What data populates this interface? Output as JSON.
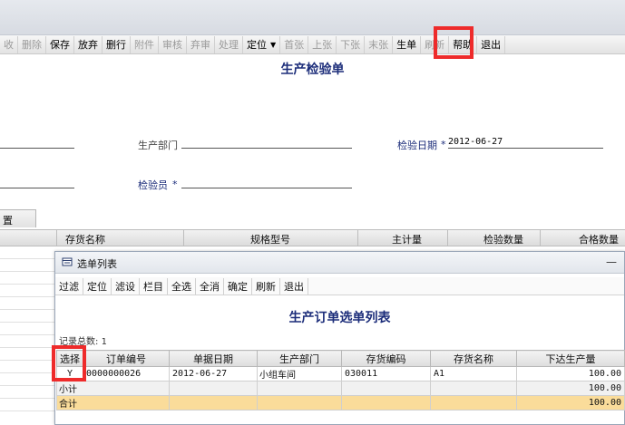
{
  "toolbar": {
    "items": [
      {
        "label": "收",
        "disabled": true
      },
      {
        "label": "删除",
        "disabled": true
      },
      {
        "label": "保存",
        "disabled": false
      },
      {
        "label": "放弃",
        "disabled": false
      },
      {
        "label": "删行",
        "disabled": false
      },
      {
        "label": "附件",
        "disabled": true
      },
      {
        "label": "审核",
        "disabled": true
      },
      {
        "label": "弃审",
        "disabled": true
      },
      {
        "label": "处理",
        "disabled": true
      },
      {
        "label": "定位",
        "disabled": false
      },
      {
        "label": "首张",
        "disabled": true
      },
      {
        "label": "上张",
        "disabled": true
      },
      {
        "label": "下张",
        "disabled": true
      },
      {
        "label": "末张",
        "disabled": true
      },
      {
        "label": "生单",
        "disabled": false
      },
      {
        "label": "刷新",
        "disabled": true
      },
      {
        "label": "帮助",
        "disabled": false
      },
      {
        "label": "退出",
        "disabled": false
      }
    ]
  },
  "form": {
    "title": "生产检验单",
    "production_dept_label": "生产部门",
    "inspection_date_label": "检验日期",
    "inspection_date_value": "2012-06-27",
    "inspector_label": "检验员",
    "required_mark": "*"
  },
  "tab": {
    "label": "置"
  },
  "outer_grid": {
    "columns": [
      "存货名称",
      "规格型号",
      "主计量",
      "检验数量",
      "合格数量"
    ]
  },
  "dialog": {
    "title": "选单列表",
    "minimize": "—",
    "toolbar": [
      "过滤",
      "定位",
      "滤设",
      "栏目",
      "全选",
      "全消",
      "确定",
      "刷新",
      "退出"
    ],
    "heading": "生产订单选单列表",
    "record_count_label": "记录总数:",
    "record_count": "1",
    "columns": [
      "选择",
      "订单编号",
      "单据日期",
      "生产部门",
      "存货编码",
      "存货名称",
      "下达生产量"
    ],
    "rows": [
      {
        "select": "Y",
        "order_no": "0000000026",
        "date": "2012-06-27",
        "dept": "小组车间",
        "item_code": "030011",
        "item_name": "A1",
        "qty": "100.00"
      }
    ],
    "subtotal_label": "小计",
    "subtotal_qty": "100.00",
    "total_label": "合计",
    "total_qty": "100.00"
  },
  "colors": {
    "highlight": "#ee2b2b",
    "heading": "#1c2d7a",
    "total_row": "#fadc9a"
  }
}
